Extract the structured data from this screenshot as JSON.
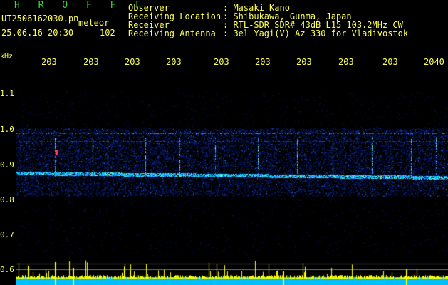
{
  "header": {
    "title": "H R O F F T",
    "filename": "UT2506162030.pn",
    "type_label": "meteor",
    "datetime": "25.06.16 20:30",
    "count": "102",
    "fields": [
      {
        "label": "Observer",
        "value": ": Masaki Kano"
      },
      {
        "label": "Receiving Location",
        "value": ": Shibukawa, Gunma, Japan"
      },
      {
        "label": "Receiver",
        "value": ": RTL-SDR SDR# 43dB L15 103.2MHz CW"
      },
      {
        "label": "Receiving Antenna",
        "value": ": 3el Yagi(V) Az 330 for Vladivostok"
      }
    ]
  },
  "axis": {
    "unit": "kHz",
    "time_ticks": [
      "203",
      "203",
      "203",
      "203",
      "203",
      "203",
      "203",
      "203",
      "203",
      "2040"
    ],
    "freq_ticks": [
      "1.1",
      "1.0",
      "0.9",
      "0.8",
      "0.7",
      "0.6"
    ]
  },
  "colors": {
    "text": "#ffff55",
    "title": "#33dd33",
    "background": "#000000",
    "noise": "#0a2a8a",
    "signal": "#00e0ff",
    "bottom_bar": "#00bfff",
    "spike": "#ffff00"
  }
}
